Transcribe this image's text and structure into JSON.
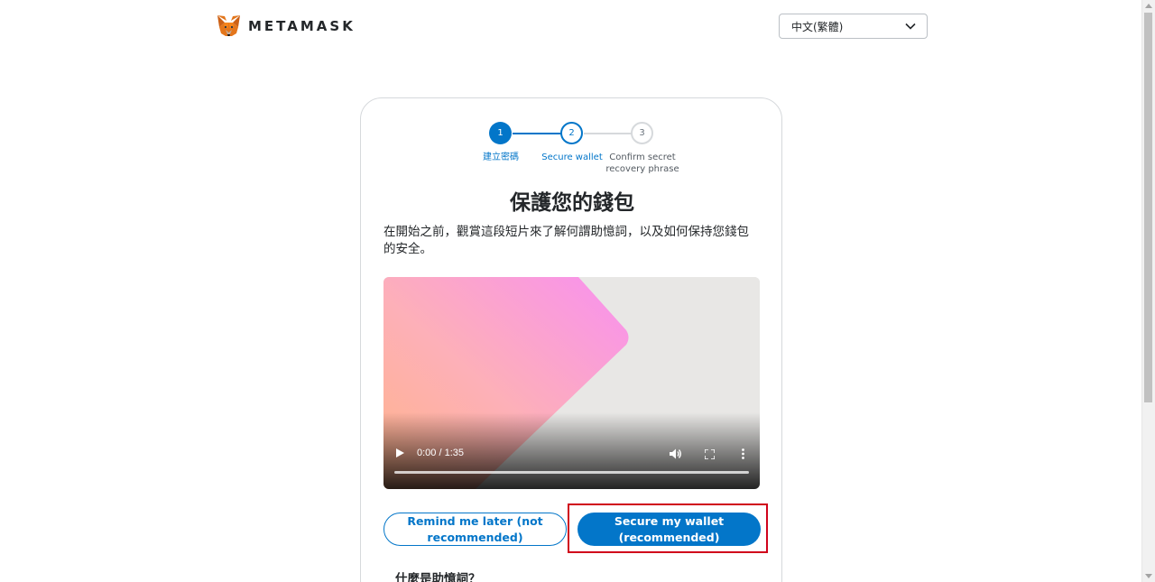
{
  "header": {
    "brand": "METAMASK",
    "language": "中文(繁體)"
  },
  "stepper": {
    "steps": [
      {
        "number": "1",
        "label": "建立密碼"
      },
      {
        "number": "2",
        "label": "Secure wallet"
      },
      {
        "number": "3",
        "label": "Confirm secret recovery phrase"
      }
    ],
    "current_step": 2
  },
  "main": {
    "title": "保護您的錢包",
    "description": "在開始之前，觀賞這段短片來了解何謂助憶詞，以及如何保持您錢包的安全。",
    "video": {
      "time": "0:00 / 1:35",
      "progress": 0
    },
    "buttons": {
      "remind_later": "Remind me later (not recommended)",
      "secure_wallet": "Secure my wallet (recommended)"
    },
    "faq_heading": "什麼是助憶詞？"
  },
  "colors": {
    "accent": "#0376c9",
    "highlight": "#d0021b",
    "fox_orange": "#e2761b"
  },
  "icons": {
    "logo": "metamask-fox-icon",
    "dropdown": "chevron-down-icon",
    "play": "play-icon",
    "volume": "volume-icon",
    "fullscreen": "fullscreen-icon",
    "more": "more-vertical-icon"
  }
}
